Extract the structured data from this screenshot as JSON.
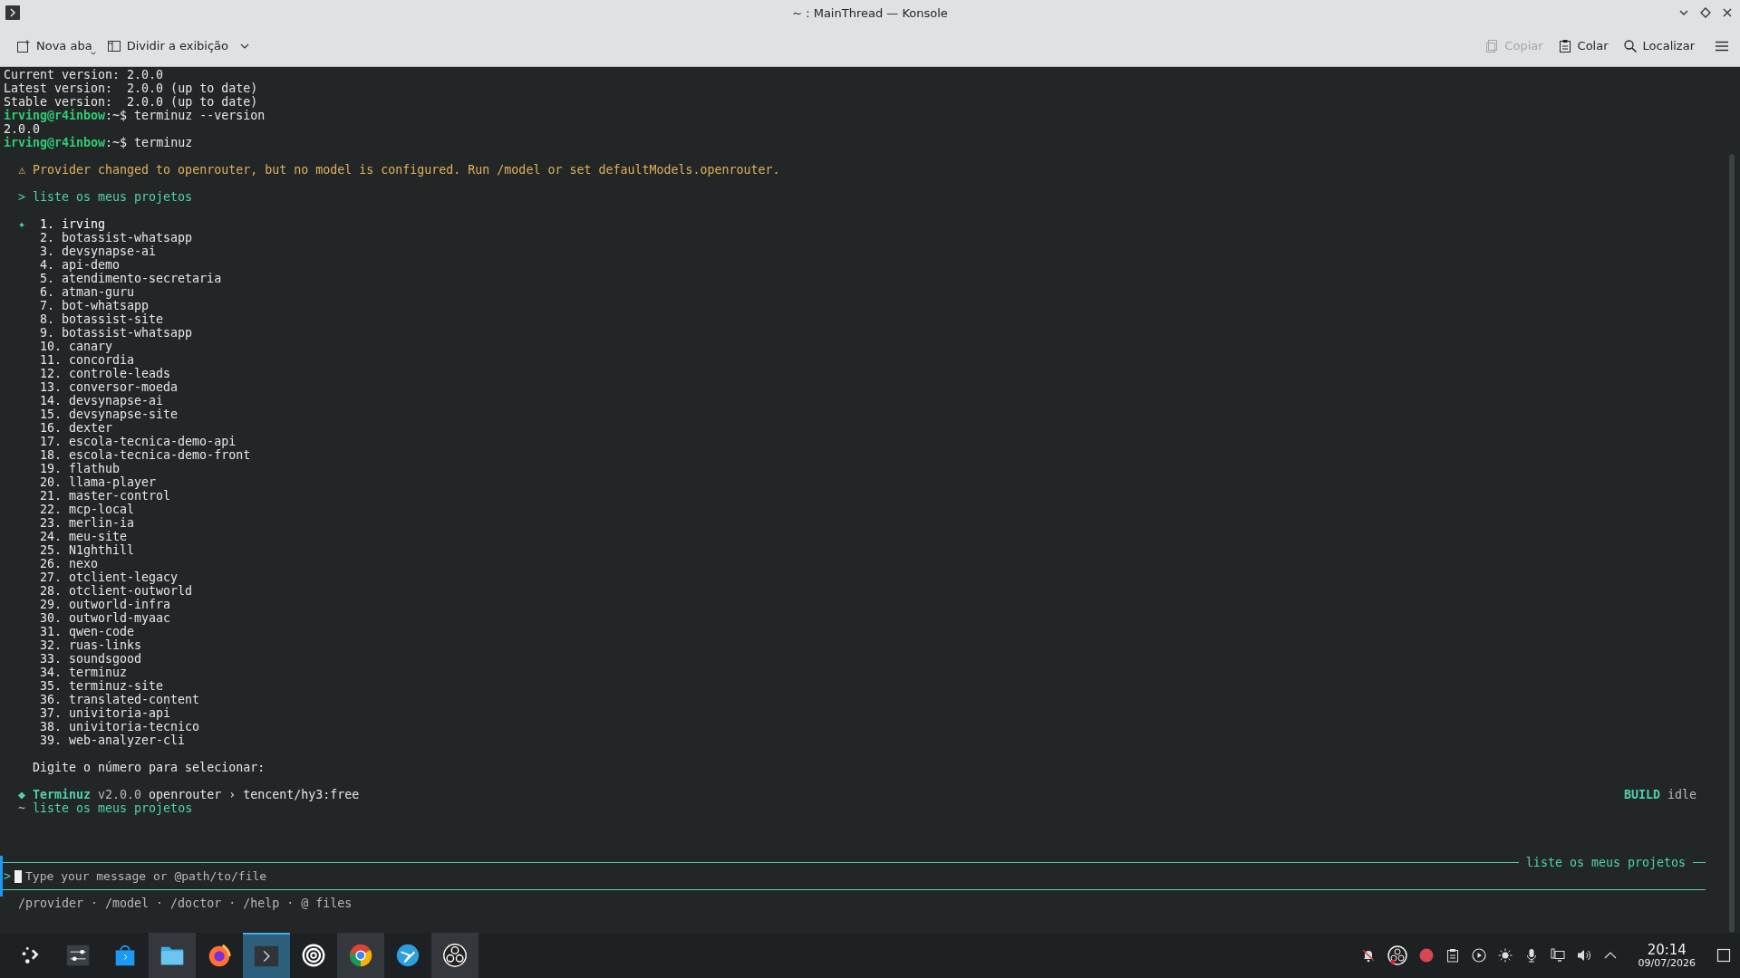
{
  "window": {
    "title": "~ : MainThread — Konsole"
  },
  "toolbar": {
    "left": [
      {
        "label": "Nova aba",
        "kind": "new-tab"
      },
      {
        "label": "Dividir a exibição",
        "kind": "split"
      }
    ],
    "right": [
      {
        "label": "Copiar",
        "kind": "copy",
        "disabled": true
      },
      {
        "label": "Colar",
        "kind": "paste",
        "disabled": false
      },
      {
        "label": "Localizar",
        "kind": "search",
        "disabled": false
      }
    ]
  },
  "terminal": {
    "lines": [
      {
        "kind": "text",
        "text": "Current version: 2.0.0"
      },
      {
        "kind": "text",
        "text": "Latest version:  2.0.0 (up to date)"
      },
      {
        "kind": "text",
        "text": "Stable version:  2.0.0 (up to date)"
      },
      {
        "kind": "prompt",
        "prompt": "irving@r4inbow",
        "path": ":~$",
        "command": "terminuz --version"
      },
      {
        "kind": "text",
        "text": "2.0.0"
      },
      {
        "kind": "prompt",
        "prompt": "irving@r4inbow",
        "path": ":~$",
        "command": "terminuz"
      }
    ],
    "warning": "⚠ Provider changed to openrouter, but no model is configured. Run /model or set defaultModels.openrouter.",
    "user_message": "> liste os meus projetos",
    "cursor_mark": "✦",
    "projects": [
      {
        "label": "1. irving",
        "selected": true
      },
      {
        "label": "2. botassist-whatsapp",
        "selected": false
      },
      {
        "label": "3. devsynapse-ai",
        "selected": false
      },
      {
        "label": "4. api-demo",
        "selected": false
      },
      {
        "label": "5. atendimento-secretaria",
        "selected": false
      },
      {
        "label": "6. atman-guru",
        "selected": false
      },
      {
        "label": "7. bot-whatsapp",
        "selected": false
      },
      {
        "label": "8. botassist-site",
        "selected": false
      },
      {
        "label": "9. botassist-whatsapp",
        "selected": false
      },
      {
        "label": "10. canary",
        "selected": false
      },
      {
        "label": "11. concordia",
        "selected": false
      },
      {
        "label": "12. controle-leads",
        "selected": false
      },
      {
        "label": "13. conversor-moeda",
        "selected": false
      },
      {
        "label": "14. devsynapse-ai",
        "selected": false
      },
      {
        "label": "15. devsynapse-site",
        "selected": false
      },
      {
        "label": "16. dexter",
        "selected": false
      },
      {
        "label": "17. escola-tecnica-demo-api",
        "selected": false
      },
      {
        "label": "18. escola-tecnica-demo-front",
        "selected": false
      },
      {
        "label": "19. flathub",
        "selected": false
      },
      {
        "label": "20. llama-player",
        "selected": false
      },
      {
        "label": "21. master-control",
        "selected": false
      },
      {
        "label": "22. mcp-local",
        "selected": false
      },
      {
        "label": "23. merlin-ia",
        "selected": false
      },
      {
        "label": "24. meu-site",
        "selected": false
      },
      {
        "label": "25. N1ghthill",
        "selected": false
      },
      {
        "label": "26. nexo",
        "selected": false
      },
      {
        "label": "27. otclient-legacy",
        "selected": false
      },
      {
        "label": "28. otclient-outworld",
        "selected": false
      },
      {
        "label": "29. outworld-infra",
        "selected": false
      },
      {
        "label": "30. outworld-myaac",
        "selected": false
      },
      {
        "label": "31. qwen-code",
        "selected": false
      },
      {
        "label": "32. ruas-links",
        "selected": false
      },
      {
        "label": "33. soundsgood",
        "selected": false
      },
      {
        "label": "34. terminuz",
        "selected": false
      },
      {
        "label": "35. terminuz-site",
        "selected": false
      },
      {
        "label": "36. translated-content",
        "selected": false
      },
      {
        "label": "37. univitoria-api",
        "selected": false
      },
      {
        "label": "38. univitoria-tecnico",
        "selected": false
      },
      {
        "label": "39. web-analyzer-cli",
        "selected": false
      }
    ],
    "select_prompt": "Digite o número para selecionar:",
    "status": {
      "mark": "◆",
      "app": "Terminuz",
      "version": "v2.0.0",
      "route": "openrouter › tencent/hy3:free",
      "mode": "BUILD",
      "state": "idle"
    },
    "last_message": {
      "mark": "~",
      "text": "liste os meus projetos"
    },
    "input": {
      "title": "liste os meus projetos",
      "prompt": ">",
      "placeholder": "Type your message or @path/to/file"
    },
    "commands": "/provider · /model · /doctor · /help · @ files"
  },
  "taskbar": {
    "apps": [
      {
        "kind": "launcher",
        "running": false,
        "active": false
      },
      {
        "kind": "settings",
        "running": false,
        "active": false
      },
      {
        "kind": "store",
        "running": false,
        "active": false
      },
      {
        "kind": "files",
        "running": true,
        "active": false
      },
      {
        "kind": "firefox",
        "running": false,
        "active": false
      },
      {
        "kind": "terminal",
        "running": true,
        "active": true
      },
      {
        "kind": "rings",
        "running": false,
        "active": false
      },
      {
        "kind": "chrome",
        "running": true,
        "active": false
      },
      {
        "kind": "bird",
        "running": false,
        "active": false
      },
      {
        "kind": "obs",
        "running": true,
        "active": false
      }
    ],
    "time": "20:14",
    "date": "09/07/2026"
  }
}
